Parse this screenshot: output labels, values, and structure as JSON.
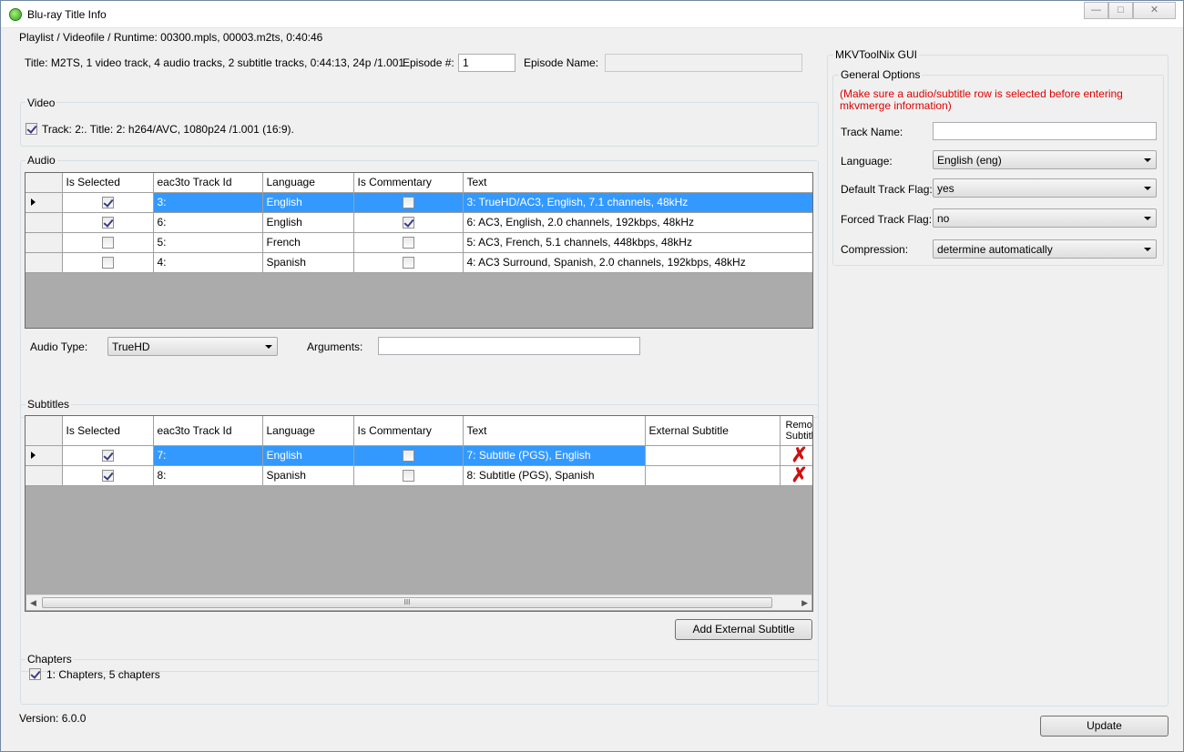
{
  "window": {
    "title": "Blu-ray Title Info",
    "controls": {
      "minimize": "—",
      "maximize": "□",
      "close": "✕"
    }
  },
  "playlist_label": "Playlist / Videofile / Runtime: 00300.mpls, 00003.m2ts, 0:40:46",
  "title_info": "Title: M2TS, 1 video track, 4 audio tracks, 2 subtitle tracks, 0:44:13, 24p /1.001",
  "episode": {
    "label": "Episode #:",
    "value": "1",
    "name_label": "Episode Name:",
    "name_value": ""
  },
  "video": {
    "group_label": "Video",
    "track": {
      "checked": true,
      "label": "Track: 2:. Title: 2: h264/AVC, 1080p24 /1.001 (16:9)."
    }
  },
  "audio": {
    "group_label": "Audio",
    "columns": [
      "Is Selected",
      "eac3to Track Id",
      "Language",
      "Is Commentary",
      "Text"
    ],
    "rows": [
      {
        "selected": true,
        "track_id": "3:",
        "language": "English",
        "commentary": false,
        "text": "3: TrueHD/AC3, English, 7.1 channels, 48kHz",
        "current": true
      },
      {
        "selected": true,
        "track_id": "6:",
        "language": "English",
        "commentary": true,
        "text": "6: AC3, English, 2.0 channels, 192kbps, 48kHz",
        "current": false
      },
      {
        "selected": false,
        "track_id": "5:",
        "language": "French",
        "commentary": false,
        "text": "5: AC3, French, 5.1 channels, 448kbps, 48kHz",
        "current": false
      },
      {
        "selected": false,
        "track_id": "4:",
        "language": "Spanish",
        "commentary": false,
        "text": "4: AC3 Surround, Spanish, 2.0 channels, 192kbps, 48kHz",
        "current": false
      }
    ],
    "type_label": "Audio Type:",
    "type_value": "TrueHD",
    "arguments_label": "Arguments:",
    "arguments_value": ""
  },
  "subtitles": {
    "group_label": "Subtitles",
    "columns": [
      "Is Selected",
      "eac3to Track Id",
      "Language",
      "Is Commentary",
      "Text",
      "External Subtitle",
      "Remo Subtitl"
    ],
    "rows": [
      {
        "selected": true,
        "track_id": "7:",
        "language": "English",
        "commentary": false,
        "text": "7: Subtitle (PGS), English",
        "external": "",
        "current": true
      },
      {
        "selected": true,
        "track_id": "8:",
        "language": "Spanish",
        "commentary": false,
        "text": "8: Subtitle (PGS), Spanish",
        "external": "",
        "current": false
      }
    ],
    "add_button": "Add External Subtitle",
    "scroll_grip": "III"
  },
  "chapters": {
    "group_label": "Chapters",
    "item": {
      "checked": true,
      "label": "1: Chapters, 5 chapters"
    }
  },
  "version": "Version: 6.0.0",
  "mkv": {
    "group_label": "MKVToolNix GUI",
    "general_label": "General Options",
    "warning": "(Make sure a audio/subtitle row is selected before entering mkvmerge information)",
    "track_name_label": "Track Name:",
    "track_name_value": "",
    "language_label": "Language:",
    "language_value": "English (eng)",
    "default_flag_label": "Default Track Flag:",
    "default_flag_value": "yes",
    "forced_flag_label": "Forced Track Flag:",
    "forced_flag_value": "no",
    "compression_label": "Compression:",
    "compression_value": "determine automatically"
  },
  "update_button": "Update",
  "colors": {
    "selection": "#3399ff",
    "warning": "#e00000",
    "remove_icon": "#cc1111"
  }
}
